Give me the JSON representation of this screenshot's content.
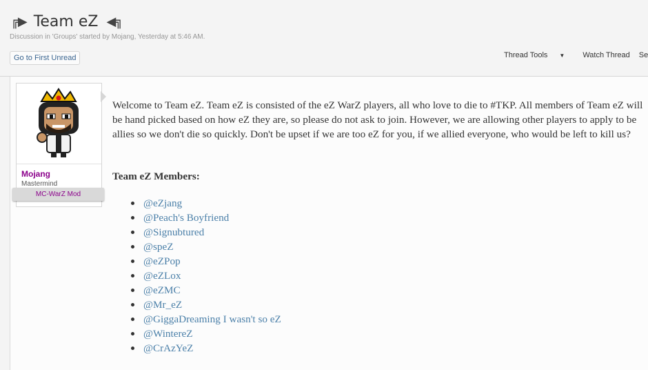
{
  "thread": {
    "title": "Team eZ",
    "title_deco_left": "╔▶",
    "title_deco_right": "◀╗",
    "meta": "Discussion in 'Groups' started by Mojang, Yesterday at 5:46 AM."
  },
  "toolbar": {
    "first_unread": "Go to First Unread",
    "thread_tools": "Thread Tools",
    "thread_tools_caret": "▼",
    "watch_thread": "Watch Thread",
    "selected": "Selected I"
  },
  "user": {
    "name": "Mojang",
    "title": "Mastermind",
    "ribbon": "MC-WarZ Mod"
  },
  "post": {
    "body": "Welcome to Team eZ. Team eZ is consisted of the eZ WarZ players, all who love to die to #TKP. All members of Team eZ will be hand picked based on how eZ they are, so please do not ask to join. However, we are allowing other players to apply to be allies so we don't die so quickly. Don't be upset if we are too eZ for you, if we allied everyone, who would be left to kill us?",
    "members_heading": "Team eZ Members:",
    "members": [
      "@eZjang",
      "@Peach's Boyfriend",
      "@Signubtured",
      "@speZ",
      "@eZPop",
      "@eZLox",
      "@eZMC",
      "@Mr_eZ",
      "@GiggaDreaming I wasn't so eZ",
      "@WintereZ",
      "@CrAzYeZ"
    ]
  },
  "colors": {
    "link": "#4a7fa8",
    "username": "#8b008b"
  }
}
